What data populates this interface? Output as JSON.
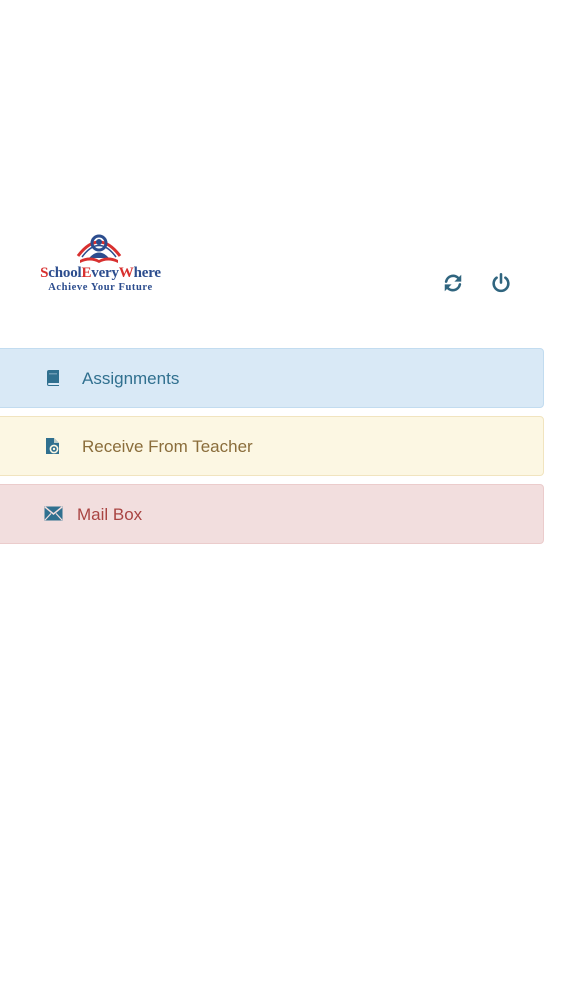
{
  "header": {
    "logo": {
      "name_part1_initial": "S",
      "name_part1_rest": "chool",
      "name_part2_initial": "E",
      "name_part2_rest": "very",
      "name_part3_initial": "W",
      "name_part3_rest": "here",
      "tagline": "Achieve Your Future"
    },
    "refresh_icon": "refresh-icon",
    "power_icon": "power-icon"
  },
  "menu": {
    "items": [
      {
        "label": "Assignments",
        "icon": "book-icon",
        "color": "#30708f",
        "background": "#d9e9f6"
      },
      {
        "label": "Receive From Teacher",
        "icon": "file-gear-icon",
        "color": "#8a6d3b",
        "background": "#fcf7e3"
      },
      {
        "label": "Mail Box",
        "icon": "envelope-icon",
        "color": "#a94442",
        "background": "#f2dede"
      }
    ]
  },
  "colors": {
    "brand_red": "#d8302f",
    "brand_blue": "#2c4d8e",
    "header_icon": "#30657f"
  }
}
